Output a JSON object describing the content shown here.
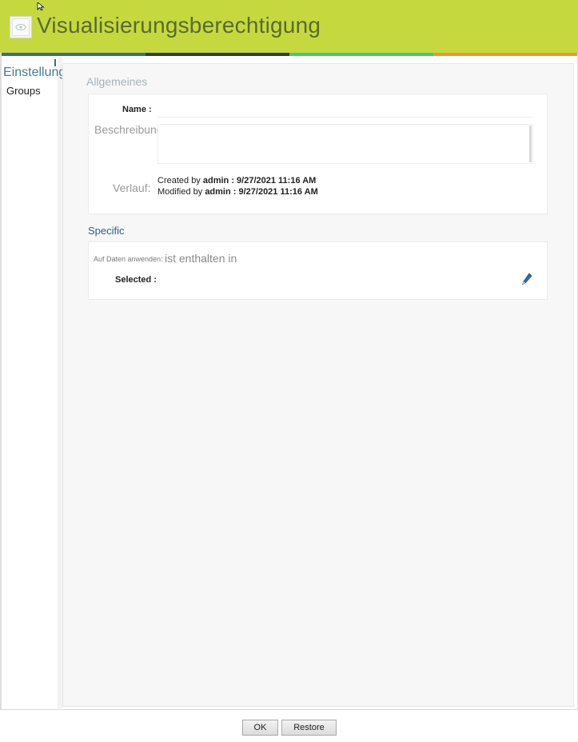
{
  "window": {
    "title": "Visualisierungsberechtigung",
    "icon": "eye-icon"
  },
  "sidebar": {
    "header": "Einstellungen",
    "items": [
      {
        "label": "Groups"
      }
    ]
  },
  "general": {
    "section_title": "Allgemeines",
    "name_label": "Name :",
    "name_value": "",
    "description_label": "Beschreibung:",
    "description_value": "",
    "history_label": "Verlauf:",
    "created_prefix": "Created by ",
    "created_text": "admin : 9/27/2021 11:16 AM",
    "modified_prefix": "Modified by ",
    "modified_text": "admin : 9/27/2021 11:16 AM"
  },
  "specific": {
    "section_title": "Specific",
    "apply_label": "Auf Daten anwenden:",
    "apply_value": "ist enthalten in",
    "selected_label": "Selected :",
    "edit_icon": "pencil-icon"
  },
  "footer": {
    "ok_label": "OK",
    "restore_label": "Restore"
  },
  "colors": {
    "titlebar": "#c5d93f",
    "accent_blue": "#3d6c86",
    "stripe_dark": "#2e3a40",
    "stripe_green": "#3fcc74",
    "stripe_orange": "#f0962e"
  }
}
